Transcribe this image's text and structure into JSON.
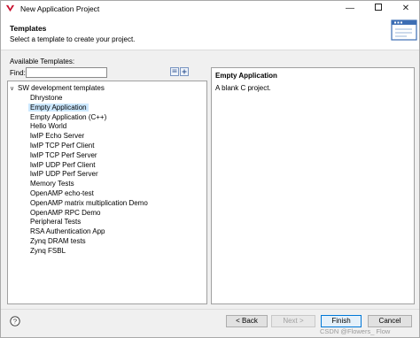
{
  "window": {
    "title": "New Application Project"
  },
  "header": {
    "title": "Templates",
    "description": "Select a template to create your project."
  },
  "left": {
    "available_label": "Available Templates:",
    "find_label": "Find:",
    "find_value": "",
    "tree_root": "SW development templates",
    "items": [
      {
        "label": "Dhrystone",
        "selected": false
      },
      {
        "label": "Empty Application",
        "selected": true
      },
      {
        "label": "Empty Application (C++)",
        "selected": false
      },
      {
        "label": "Hello World",
        "selected": false
      },
      {
        "label": "lwIP Echo Server",
        "selected": false
      },
      {
        "label": "lwIP TCP Perf Client",
        "selected": false
      },
      {
        "label": "lwIP TCP Perf Server",
        "selected": false
      },
      {
        "label": "lwIP UDP Perf Client",
        "selected": false
      },
      {
        "label": "lwIP UDP Perf Server",
        "selected": false
      },
      {
        "label": "Memory Tests",
        "selected": false
      },
      {
        "label": "OpenAMP echo-test",
        "selected": false
      },
      {
        "label": "OpenAMP matrix multiplication Demo",
        "selected": false
      },
      {
        "label": "OpenAMP RPC Demo",
        "selected": false
      },
      {
        "label": "Peripheral Tests",
        "selected": false
      },
      {
        "label": "RSA Authentication App",
        "selected": false
      },
      {
        "label": "Zynq DRAM tests",
        "selected": false
      },
      {
        "label": "Zynq FSBL",
        "selected": false
      }
    ]
  },
  "description": {
    "title": "Empty Application",
    "text": "A blank C project."
  },
  "footer": {
    "back_label": "< Back",
    "next_label": "Next >",
    "finish_label": "Finish",
    "cancel_label": "Cancel"
  },
  "watermark": "CSDN @Flowers_ Flow",
  "icons": {
    "app": "vitis-logo-icon",
    "banner": "wizard-banner-icon",
    "collapse": "collapse-all-icon",
    "expand": "expand-all-icon",
    "help": "help-icon"
  },
  "colors": {
    "selection": "#cce8ff",
    "default_button_border": "#0078d7",
    "logo": "#c8102e"
  }
}
